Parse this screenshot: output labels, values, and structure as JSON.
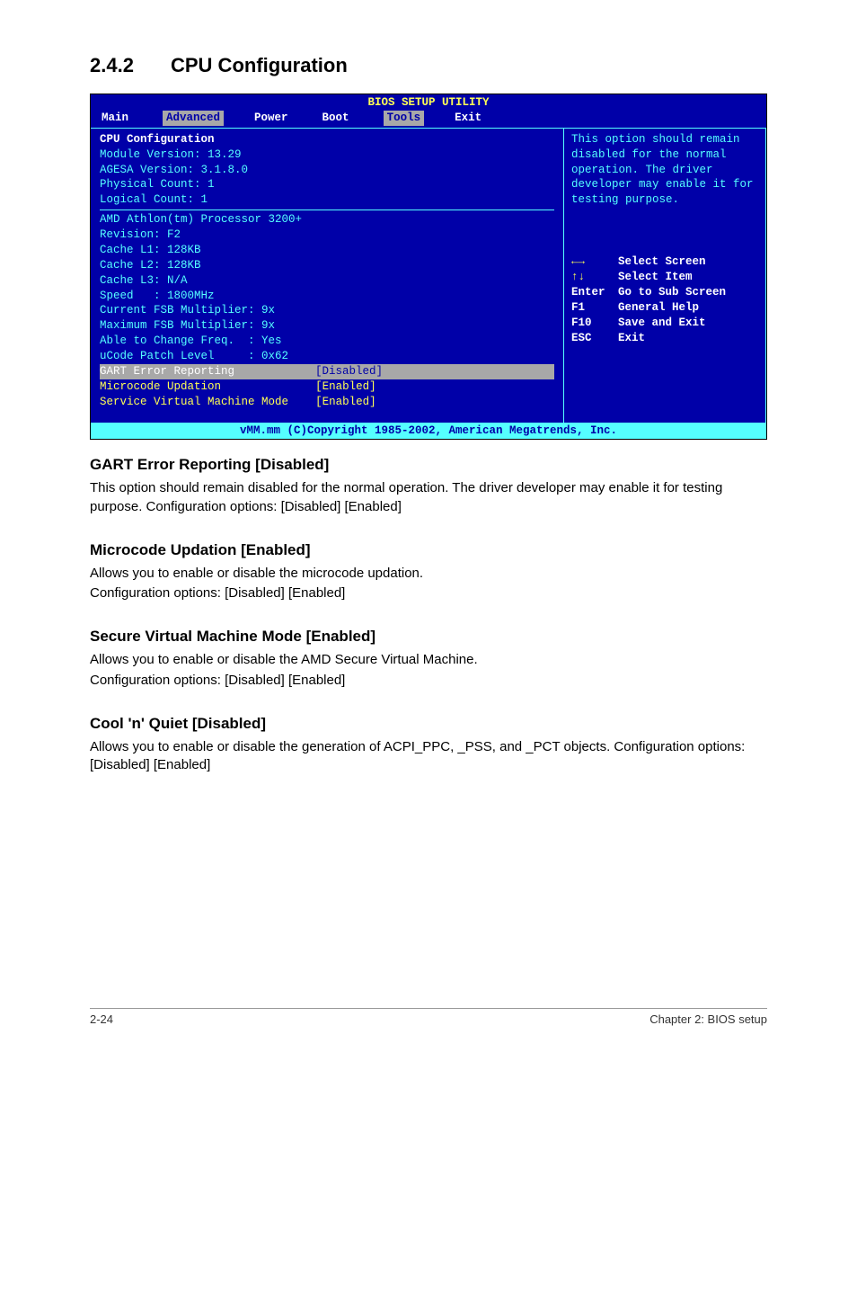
{
  "header": {
    "number": "2.4.2",
    "title": "CPU Configuration"
  },
  "bios": {
    "title": "BIOS SETUP UTILITY",
    "menu": {
      "main": "Main",
      "advanced": "Advanced",
      "power": "Power",
      "boot": "Boot",
      "tools": "Tools",
      "exit": "Exit"
    },
    "left": {
      "cfg_title": "CPU Configuration",
      "lines_top": [
        "Module Version: 13.29",
        "AGESA Version: 3.1.8.0",
        "Physical Count: 1",
        "Logical Count: 1"
      ],
      "lines_mid": [
        "AMD Athlon(tm) Processor 3200+",
        "Revision: F2",
        "Cache L1: 128KB",
        "Cache L2: 128KB",
        "Cache L3: N/A",
        "Speed   : 1800MHz",
        "Current FSB Multiplier: 9x",
        "Maximum FSB Multiplier: 9x",
        "Able to Change Freq.  : Yes",
        "uCode Patch Level     : 0x62"
      ],
      "options": [
        {
          "label": "GART Error Reporting",
          "value": "[Disabled]",
          "selected": true
        },
        {
          "label": "Microcode Updation",
          "value": "[Enabled]",
          "selected": false
        },
        {
          "label": "Service Virtual Machine Mode",
          "value": "[Enabled]",
          "selected": false
        }
      ]
    },
    "right": {
      "desc": "This option should remain disabled for the normal operation. The driver developer may enable it for testing purpose.",
      "keys": [
        {
          "k": "←→",
          "a": "Select Screen"
        },
        {
          "k": "↑↓",
          "a": "Select Item"
        },
        {
          "k": "Enter",
          "a": "Go to Sub Screen"
        },
        {
          "k": "F1",
          "a": "General Help"
        },
        {
          "k": "F10",
          "a": "Save and Exit"
        },
        {
          "k": "ESC",
          "a": "Exit"
        }
      ]
    },
    "footer": "vMM.mm (C)Copyright 1985-2002, American Megatrends, Inc."
  },
  "sections": {
    "s1": {
      "title": "GART Error Reporting [Disabled]",
      "p1": "This option should remain disabled for the normal operation. The driver developer may enable it for testing purpose. Configuration options: [Disabled] [Enabled]"
    },
    "s2": {
      "title": "Microcode Updation [Enabled]",
      "p1": "Allows you to enable or disable the microcode updation.",
      "p2": "Configuration options: [Disabled] [Enabled]"
    },
    "s3": {
      "title": "Secure Virtual Machine Mode [Enabled]",
      "p1": "Allows you to enable or disable the AMD Secure Virtual Machine.",
      "p2": "Configuration options: [Disabled] [Enabled]"
    },
    "s4": {
      "title": "Cool 'n' Quiet [Disabled]",
      "p1": "Allows you to enable or disable the generation of ACPI_PPC, _PSS, and _PCT objects. Configuration options: [Disabled] [Enabled]"
    }
  },
  "footer": {
    "left": "2-24",
    "right": "Chapter 2: BIOS setup"
  }
}
